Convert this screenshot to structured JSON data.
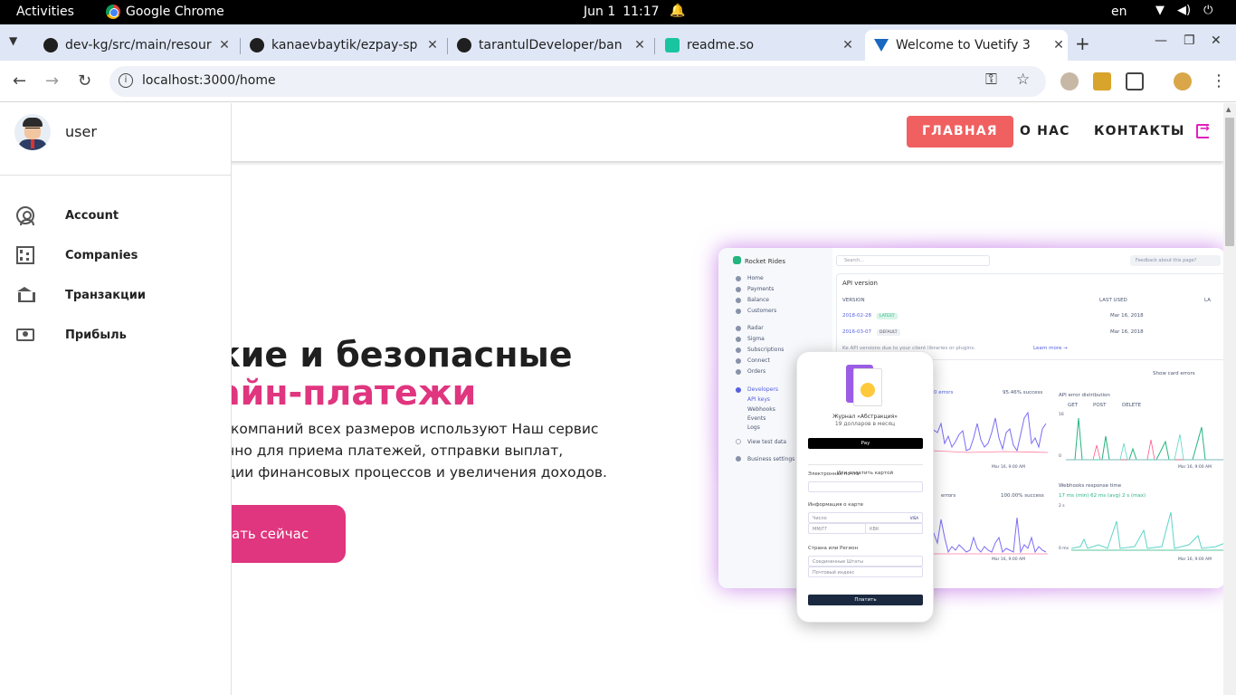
{
  "topbar": {
    "activities": "Activities",
    "app_name": "Google Chrome",
    "date": "Jun 1",
    "time": "11:17",
    "lang": "en"
  },
  "tabs": [
    {
      "title": "dev-kg/src/main/resour",
      "icon": "github-icon"
    },
    {
      "title": "kanaevbaytik/ezpay-sp",
      "icon": "github-icon"
    },
    {
      "title": "tarantulDeveloper/ban",
      "icon": "github-icon"
    },
    {
      "title": "readme.so",
      "icon": "readme-icon"
    },
    {
      "title": "Welcome to Vuetify 3",
      "icon": "vuetify-icon"
    }
  ],
  "omnibox": {
    "url": "localhost:3000/home"
  },
  "appbar": {
    "nav": [
      "ГЛАВНАЯ",
      "О НАС",
      "КОНТАКТЫ"
    ],
    "active_color": "#f06060"
  },
  "drawer": {
    "username": "user",
    "items": [
      {
        "label": "Account",
        "icon": "account-circle-icon"
      },
      {
        "label": "Companies",
        "icon": "office-building-icon"
      },
      {
        "label": "Транзакции",
        "icon": "bank-transfer-icon"
      },
      {
        "label": "Прибыль",
        "icon": "cash-icon"
      }
    ]
  },
  "hero": {
    "title_line1": "кие и безопасные",
    "title_line2": "айн-платежи",
    "text_line1": "и компаний всех размеров используют Наш сервис",
    "text_line2": "ично для приема платежей, отправки выплат,",
    "text_line3": "ации финансовых процессов и увеличения доходов.",
    "cta": "ать сейчас",
    "accent": "#e0357f"
  },
  "mock_dashboard": {
    "brand": "Rocket Rides",
    "search": "Search...",
    "feedback": "Feedback about this page?",
    "menu": [
      "Home",
      "Payments",
      "Balance",
      "Customers",
      "Radar",
      "Sigma",
      "Subscriptions",
      "Connect",
      "Orders",
      "Developers",
      "API keys",
      "Webhooks",
      "Events",
      "Logs",
      "View test data",
      "Business settings"
    ],
    "api_title": "API version",
    "col_version": "VERSION",
    "col_last_used": "LAST USED",
    "col_la": "LA",
    "rows": [
      {
        "version": "2018-02-28",
        "tag": "LATEST",
        "last_used": "Mar 16, 2018"
      },
      {
        "version": "2016-03-07",
        "tag": "DEFAULT",
        "last_used": "Mar 16, 2018"
      }
    ],
    "notice": "Ke                                   API versions due to your client libraries or plugins.",
    "learn_more": "Learn more →",
    "show_card_errors": "Show card errors",
    "errors_label": "0 errors",
    "success_1": "95.46% success",
    "api_error_dist": "API error distribution",
    "legend_get": "GET",
    "legend_post": "POST",
    "legend_delete": "DELETE",
    "time_label": "Mar 16, 9:00 AM",
    "errors_label2": "errors",
    "success_2": "100.00% success",
    "webhooks_title": "Webhooks response time",
    "webhooks_legend": "17 ms (min)    62 ms (avg)    2 s (max)",
    "y_16": "16",
    "y_2s": "2 s",
    "y_0": "0",
    "y_0ms": "0 ms"
  },
  "mock_phone": {
    "product_title": "Журнал «Абстракция»",
    "product_price": "19 долларов в месяц",
    "apple_pay": " Pay",
    "or_card": "Или оплатить картой",
    "email_label": "Электронная почта",
    "card_info": "Информация о карте",
    "card_number": "Число",
    "card_brands": "VISA",
    "expiry": "ММ/ГГ",
    "cvc": "КВК",
    "country_label": "Страна или Регион",
    "country": "Соединенные Штаты",
    "zip": "Почтовый индекс",
    "pay": "Платить"
  }
}
